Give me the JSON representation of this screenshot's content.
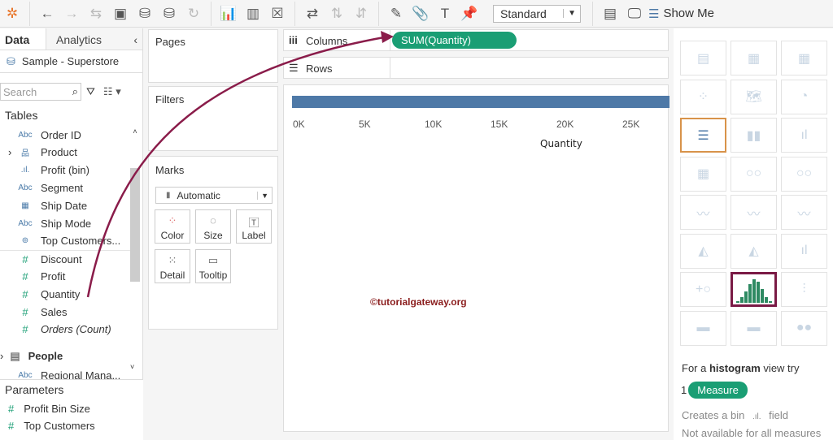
{
  "toolbar": {
    "view_mode": "Standard",
    "show_me": "Show Me"
  },
  "left": {
    "tab_data": "Data",
    "tab_analytics": "Analytics",
    "datasource": "Sample - Superstore",
    "search_placeholder": "Search",
    "tables_heading": "Tables",
    "fields": [
      {
        "type": "Abc",
        "name": "Order ID"
      },
      {
        "type": "hier",
        "name": "Product"
      },
      {
        "type": "bin",
        "name": "Profit (bin)"
      },
      {
        "type": "Abc",
        "name": "Segment"
      },
      {
        "type": "date",
        "name": "Ship Date"
      },
      {
        "type": "Abc",
        "name": "Ship Mode"
      },
      {
        "type": "set",
        "name": "Top Customers..."
      },
      {
        "type": "#",
        "name": "Discount"
      },
      {
        "type": "#",
        "name": "Profit"
      },
      {
        "type": "#",
        "name": "Quantity"
      },
      {
        "type": "#",
        "name": "Sales"
      },
      {
        "type": "#",
        "name": "Orders (Count)"
      }
    ],
    "people_table": "People",
    "people_field": "Regional Mana...",
    "parameters_heading": "Parameters",
    "parameters": [
      "Profit Bin Size",
      "Top Customers"
    ]
  },
  "cards": {
    "pages": "Pages",
    "filters": "Filters",
    "marks": "Marks",
    "mark_type": "Automatic",
    "buttons": [
      "Color",
      "Size",
      "Label",
      "Detail",
      "Tooltip"
    ]
  },
  "shelves": {
    "columns": "Columns",
    "rows": "Rows",
    "columns_pill": "SUM(Quantity)"
  },
  "view": {
    "axis_ticks": [
      "0K",
      "5K",
      "10K",
      "15K",
      "20K",
      "25K"
    ],
    "axis_title": "Quantity",
    "watermark": "©tutorialgateway.org"
  },
  "showme": {
    "hint_prefix": "For a ",
    "hint_bold": "histogram",
    "hint_suffix": " view try",
    "count": "1",
    "pill": "Measure",
    "line1a": "Creates a bin",
    "line1b": "field",
    "line2": "Not available for all measures"
  },
  "colors": {
    "pill": "#1a9e74",
    "bar": "#4e79a7",
    "arrow": "#8a1c4a",
    "selected": "#7a1a45"
  }
}
